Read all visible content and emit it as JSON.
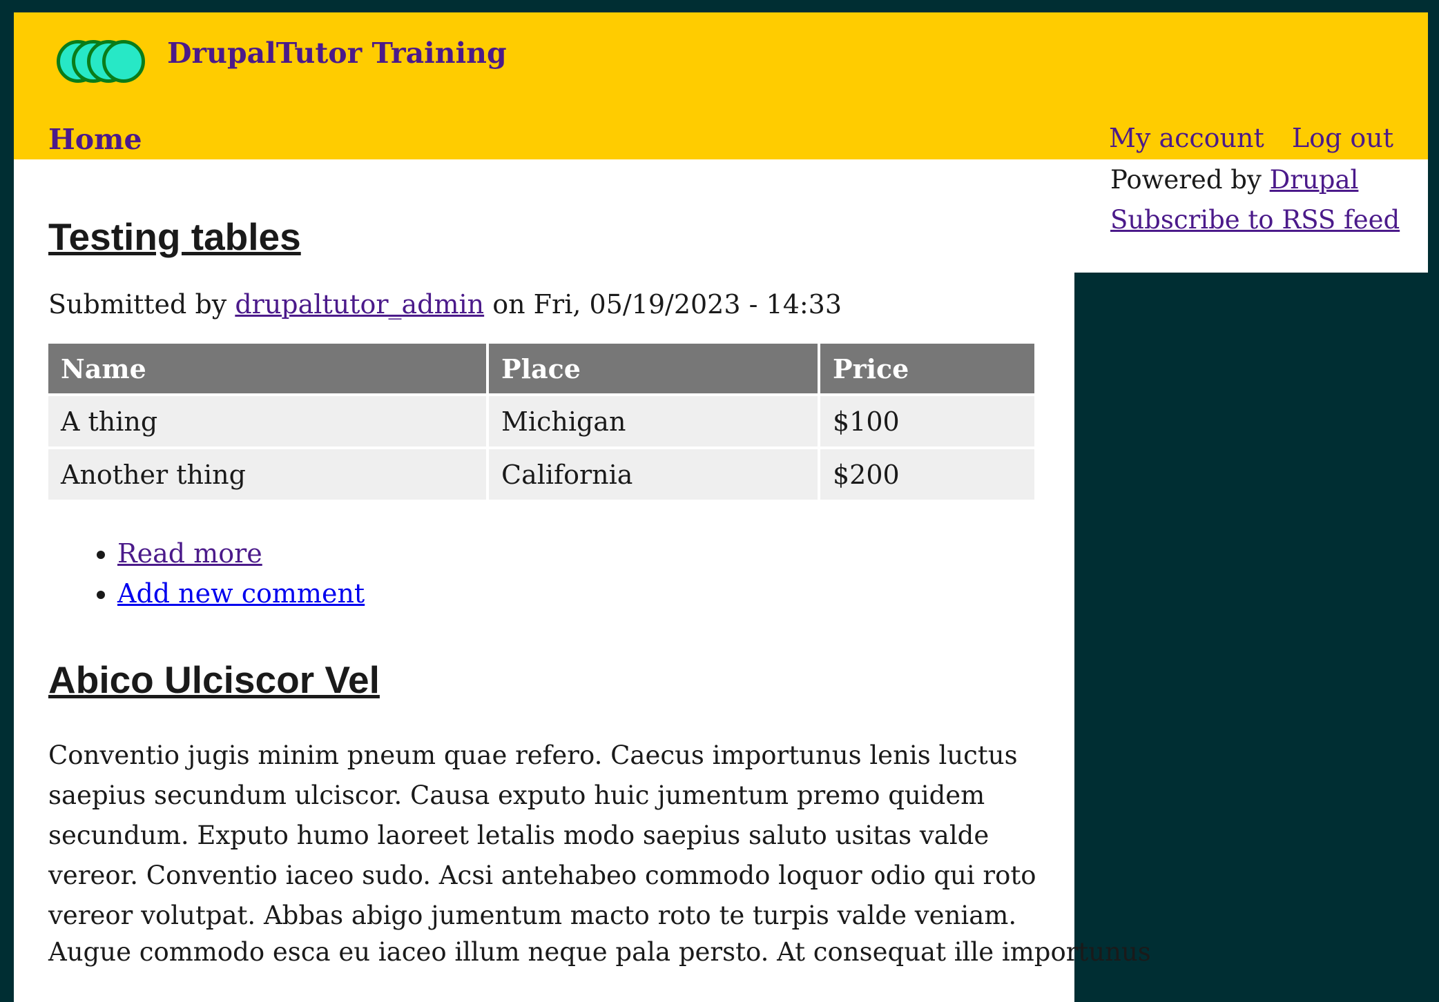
{
  "header": {
    "site_name": "DrupalTutor Training",
    "main_nav": "Home",
    "my_account": "My account",
    "log_out": "Log out"
  },
  "sidebar": {
    "powered_by": "Powered by",
    "drupal_link": "Drupal",
    "rss": "Subscribe to RSS feed"
  },
  "article1": {
    "title": "Testing tables",
    "submitted_by": "Submitted by",
    "author": "drupaltutor_admin",
    "date": "on Fri, 05/19/2023 - 14:33",
    "table": {
      "headers": [
        "Name",
        "Place",
        "Price"
      ],
      "rows": [
        [
          "A thing",
          "Michigan",
          "$100"
        ],
        [
          "Another thing",
          "California",
          "$200"
        ]
      ]
    },
    "read_more": "Read more",
    "add_comment": "Add new comment"
  },
  "article2": {
    "title": "Abico Ulciscor Vel",
    "para1": "Conventio jugis minim pneum quae refero. Caecus importunus lenis luctus saepius secundum ulciscor. Causa exputo huic jumentum premo quidem secundum. Exputo humo laoreet letalis modo saepius saluto usitas valde vereor. Conventio iaceo sudo. Acsi antehabeo commodo loquor odio qui roto vereor volutpat. Abbas abigo jumentum macto roto te turpis valde veniam.",
    "para2": "Augue commodo esca eu iaceo illum neque pala persto. At consequat ille importunus"
  },
  "colors": {
    "header_bg": "#ffcc00",
    "page_bg": "#002e33",
    "link": "#4b1a8a",
    "table_header": "#777777",
    "table_cell": "#efefef"
  }
}
